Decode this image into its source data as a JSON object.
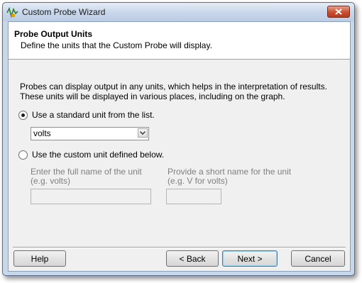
{
  "window": {
    "title": "Custom Probe Wizard"
  },
  "header": {
    "title": "Probe Output Units",
    "subtitle": "Define the units that the Custom Probe will display."
  },
  "description": "Probes can display output in any units, which helps in the interpretation of results. These units will be displayed in various places, including on the graph.",
  "options": {
    "standard_label": "Use a standard unit from the list.",
    "standard_selected": true,
    "unit_select_value": "volts",
    "custom_label": "Use the custom unit defined below.",
    "custom_selected": false
  },
  "custom": {
    "full_name_label_line1": "Enter the full name of the unit",
    "full_name_label_line2": "(e.g. volts)",
    "full_name_value": "",
    "short_name_label_line1": "Provide a short name for the unit",
    "short_name_label_line2": "(e.g. V for volts)",
    "short_name_value": ""
  },
  "buttons": {
    "help": "Help",
    "back": "< Back",
    "next": "Next >",
    "cancel": "Cancel"
  },
  "icons": {
    "app": "probe-waveform-icon",
    "close": "close-icon",
    "dropdown": "chevron-down-icon"
  }
}
